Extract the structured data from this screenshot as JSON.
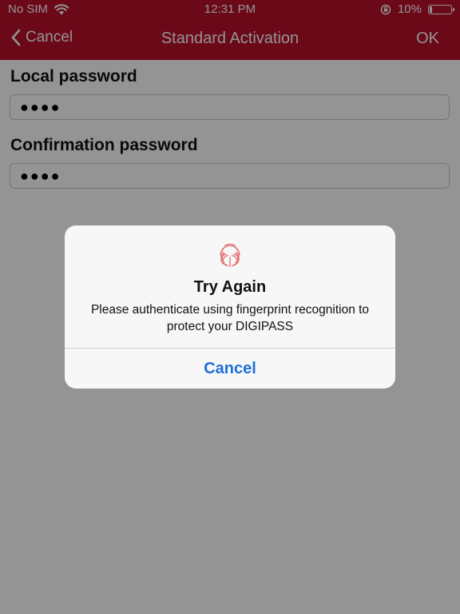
{
  "status_bar": {
    "carrier": "No SIM",
    "time": "12:31 PM",
    "battery": "10%",
    "battery_level": 0.1
  },
  "nav": {
    "cancel_label": "Cancel",
    "title": "Standard Activation",
    "ok_label": "OK"
  },
  "form": {
    "local_password_label": "Local password",
    "local_password_value": "●●●●",
    "confirmation_password_label": "Confirmation password",
    "confirmation_password_value": "●●●●"
  },
  "dialog": {
    "title": "Try Again",
    "message": "Please authenticate using fingerprint recognition to protect your DIGIPASS",
    "cancel_label": "Cancel",
    "icon": "fingerprint-icon"
  },
  "colors": {
    "header": "#b8102b",
    "dialog_button": "#1d6fd6",
    "fingerprint": "#e26d6d"
  }
}
